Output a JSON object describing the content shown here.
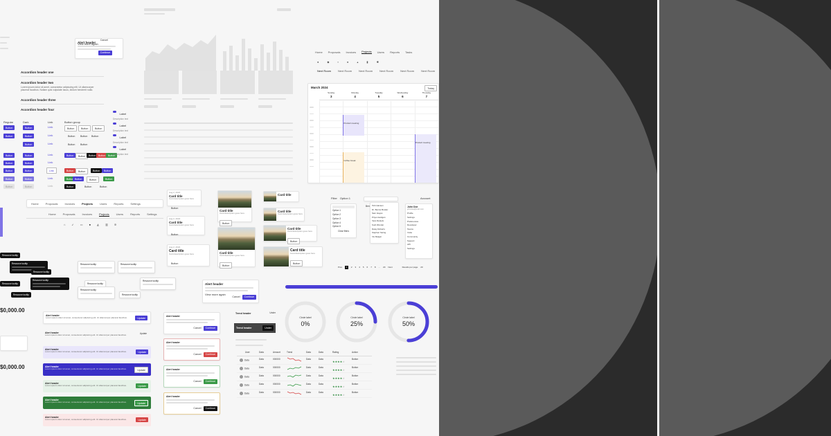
{
  "colors": {
    "primary": "#4b3fd6",
    "dark_panel": "#2b2b2b",
    "disc": "#5a5a5a",
    "success": "#3a9a48",
    "danger": "#d64545"
  },
  "labels": {
    "alert_header": "Alert header",
    "lorem_short": "Lorem ipsum dolor sit amet, consectetur adipiscing elit. Ut ullamcorper placerat faucibus.",
    "view_more": "View more again",
    "cancel": "Cancel",
    "continue": "Continue",
    "update": "Update",
    "button": "Button",
    "link": "Link",
    "label": "Label",
    "description": "Description text",
    "resource_tooltip": "Resource tooltip",
    "card_title": "Card title",
    "card_desc": "Card description goes here",
    "label_tag": "Label",
    "date_tag": "Aug 2, 2024",
    "filter": "Filter",
    "option": "Option 1",
    "option_list": [
      "Option 1",
      "Option 2",
      "Option 3",
      "Option 4",
      "Option 5"
    ],
    "clear_filters": "Clear filters",
    "trend_header": "Trend header",
    "under": "Under",
    "circle_label": "Circle label",
    "pct_0": "0%",
    "pct_25": "25%",
    "pct_50": "50%",
    "money": "$0,000.00",
    "money2": "$0,000.00",
    "money3": "$0,000.00",
    "total": "Total"
  },
  "accordion": {
    "items": [
      "Accordion header one",
      "Accordion header two",
      "Accordion header three",
      "Accordion header four"
    ],
    "body": "Lorem ipsum dolor sit amet, consectetur adipiscing elit. Ut ullamcorper placerat faucibus. Nullam quis vulputate lacus, dictum hendrerit nulla."
  },
  "button_groups": {
    "labels": [
      "Regular",
      "Dark",
      "Link",
      "Button group"
    ]
  },
  "nav": {
    "top_tabs": [
      "Home",
      "Proposals",
      "Invoices",
      "Projects",
      "Users",
      "Reports",
      "Settings"
    ],
    "active": "Projects",
    "sub_tabs": [
      "Home",
      "Proposals",
      "Invoices",
      "Projects",
      "Users",
      "Reports",
      "Settings"
    ],
    "badge": "3"
  },
  "calendar": {
    "title": "March 2024",
    "today": "Today",
    "days": [
      {
        "name": "Sunday",
        "num": "3"
      },
      {
        "name": "Monday",
        "num": "4"
      },
      {
        "name": "Tuesday",
        "num": "5"
      },
      {
        "name": "Wednesday",
        "num": "6"
      },
      {
        "name": "Thursday",
        "num": "7"
      }
    ],
    "tabs": [
      "Next Room",
      "Next Room",
      "Next Room",
      "Next Room",
      "Next Room",
      "Next Room"
    ],
    "events": [
      "Product meeting",
      "Coffee break",
      "Product meeting"
    ]
  },
  "top_tabs2": [
    "Home",
    "Proposals",
    "Invoices",
    "Projects",
    "Users",
    "Reports",
    "Tasks"
  ],
  "menu": {
    "user_name": "John Doe",
    "user_mail": "johndoe@mail.com",
    "account": "Account",
    "items": [
      "Profile",
      "Settings",
      "Preferences",
      "Developer",
      "Teams",
      "Invite",
      "Community",
      "Support",
      "API",
      "Settings"
    ],
    "people": [
      "Tobi Hansen",
      "Dr. Bernie Bowler",
      "Sam Hayes",
      "Priya Hooligan",
      "Vera Daniels",
      "Kodi Wonder",
      "Daisy Roberts",
      "Stephen Swing",
      "Iris Melgar"
    ],
    "select_label": "Bernie Bowler"
  },
  "pagination": {
    "pages": [
      "1",
      "2",
      "3",
      "4",
      "5",
      "6",
      "7",
      "8",
      "...",
      "20"
    ],
    "prev": "Prev",
    "next": "Next",
    "per_page": "Results per page",
    "per_value": "20"
  },
  "table": {
    "headers": [
      "User",
      "Data",
      "Amount",
      "Trend",
      "Data",
      "Data",
      "Rating",
      "Action"
    ],
    "rows": [
      {
        "user": "Data",
        "data": "Data",
        "amount": "000000",
        "data2": "Data",
        "data3": "Data",
        "action": "Button"
      },
      {
        "user": "Data",
        "data": "Data",
        "amount": "000000",
        "data2": "Data",
        "data3": "Data",
        "action": "Button"
      },
      {
        "user": "Data",
        "data": "Data",
        "amount": "000000",
        "data2": "Data",
        "data3": "Data",
        "action": "Button"
      },
      {
        "user": "Data",
        "data": "Data",
        "amount": "000000",
        "data2": "Data",
        "data3": "Data",
        "action": "Button"
      },
      {
        "user": "Data",
        "data": "Data",
        "amount": "000000",
        "data2": "Data",
        "data3": "Data",
        "action": "Button"
      }
    ]
  },
  "progress": {
    "circle_0": 0,
    "circle_25": 0.25,
    "circle_50": 0.5,
    "bar": 1
  }
}
